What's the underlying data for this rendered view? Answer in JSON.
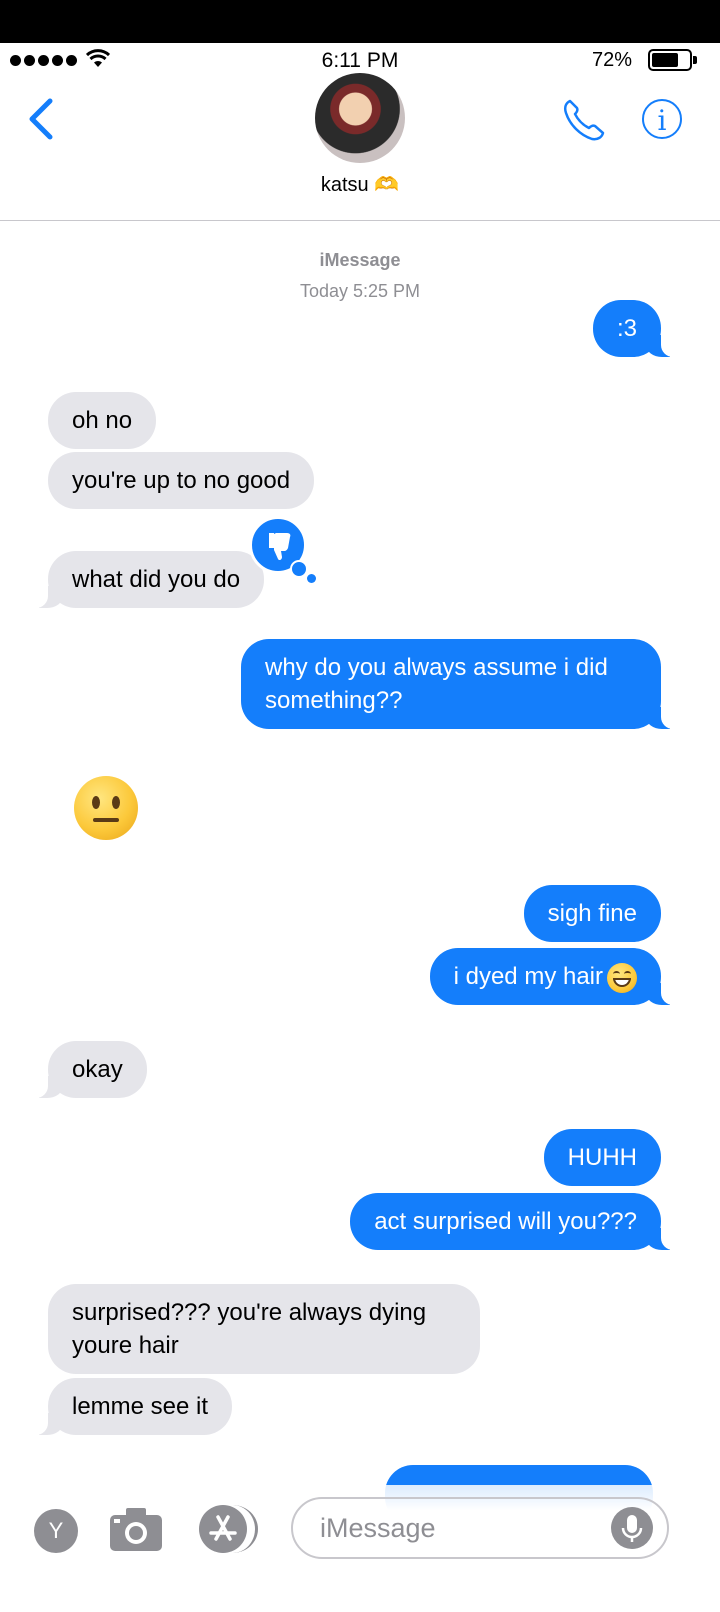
{
  "status_bar": {
    "time": "6:11 PM",
    "battery_percent": "72%",
    "battery_level": 0.72,
    "signal_bars": 5
  },
  "header": {
    "contact_name": "katsu 🫶",
    "back_icon": "chevron-left-icon",
    "call_icon": "phone-icon",
    "info_icon": "info-icon",
    "info_glyph": "i"
  },
  "thread": {
    "service": "iMessage",
    "timestamp": "Today 5:25 PM"
  },
  "messages": [
    {
      "from": "me",
      "text": ":3"
    },
    {
      "from": "them",
      "text": "oh no"
    },
    {
      "from": "them",
      "text": "you're up to no good"
    },
    {
      "from": "them",
      "text": "what did you do",
      "tapback": "thumbs-down-icon"
    },
    {
      "from": "me",
      "text": "why do you always assume i did something??"
    },
    {
      "from": "them",
      "text": "😐"
    },
    {
      "from": "me",
      "text": "sigh fine"
    },
    {
      "from": "me",
      "text": "i dyed my hair"
    },
    {
      "from": "them",
      "text": "okay"
    },
    {
      "from": "me",
      "text": "HUHH"
    },
    {
      "from": "me",
      "text": "act surprised will you???"
    },
    {
      "from": "them",
      "text": "surprised??? you're always dying youre hair"
    },
    {
      "from": "them",
      "text": "lemme see it"
    }
  ],
  "composer": {
    "placeholder": "iMessage",
    "app_button_label": "Y",
    "camera_icon": "camera-icon",
    "appstore_icon": "app-store-icon",
    "mic_icon": "microphone-icon"
  },
  "colors": {
    "accent": "#147efb",
    "incoming_bubble": "#e5e5ea",
    "outgoing_bubble": "#147efb",
    "muted": "#8e8e93"
  }
}
